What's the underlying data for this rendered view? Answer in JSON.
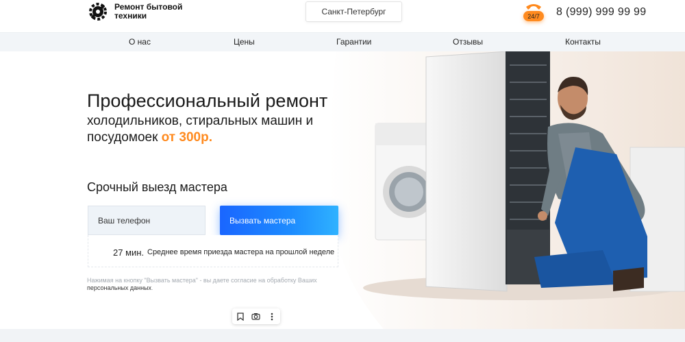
{
  "header": {
    "logo_text": "Ремонт бытовой техники",
    "city": "Санкт-Петербург",
    "badge": "24/7",
    "phone": "8 (999) 999 99 99"
  },
  "nav": {
    "items": [
      "О нас",
      "Цены",
      "Гарантии",
      "Отзывы",
      "Контакты"
    ]
  },
  "hero": {
    "title_line1": "Профессиональный ремонт",
    "title_line2": "холодильников, стиральных машин и",
    "title_line3_prefix": "посудомоек ",
    "title_price": "от 300р.",
    "urgent_title": "Срочный выезд мастера",
    "phone_placeholder": "Ваш телефон",
    "call_button": "Вызвать мастера",
    "eta_minutes": "27 мин.",
    "eta_text": "Среднее время приезда мастера на прошлой неделе",
    "consent_text": "Нажимая на кнопку \"Вызвать мастера\" - вы даете согласие на обработку Ваших",
    "consent_link": "персональных данных",
    "consent_end": "."
  },
  "colors": {
    "accent": "#ff8a1e",
    "button": "#1d8cff",
    "nav_bg": "#f2f5f8"
  },
  "icons": {
    "logo": "gear-wrench-icon",
    "phone": "phone-handset-icon",
    "toolbar": [
      "bookmark-icon",
      "camera-icon",
      "more-vertical-icon"
    ]
  }
}
